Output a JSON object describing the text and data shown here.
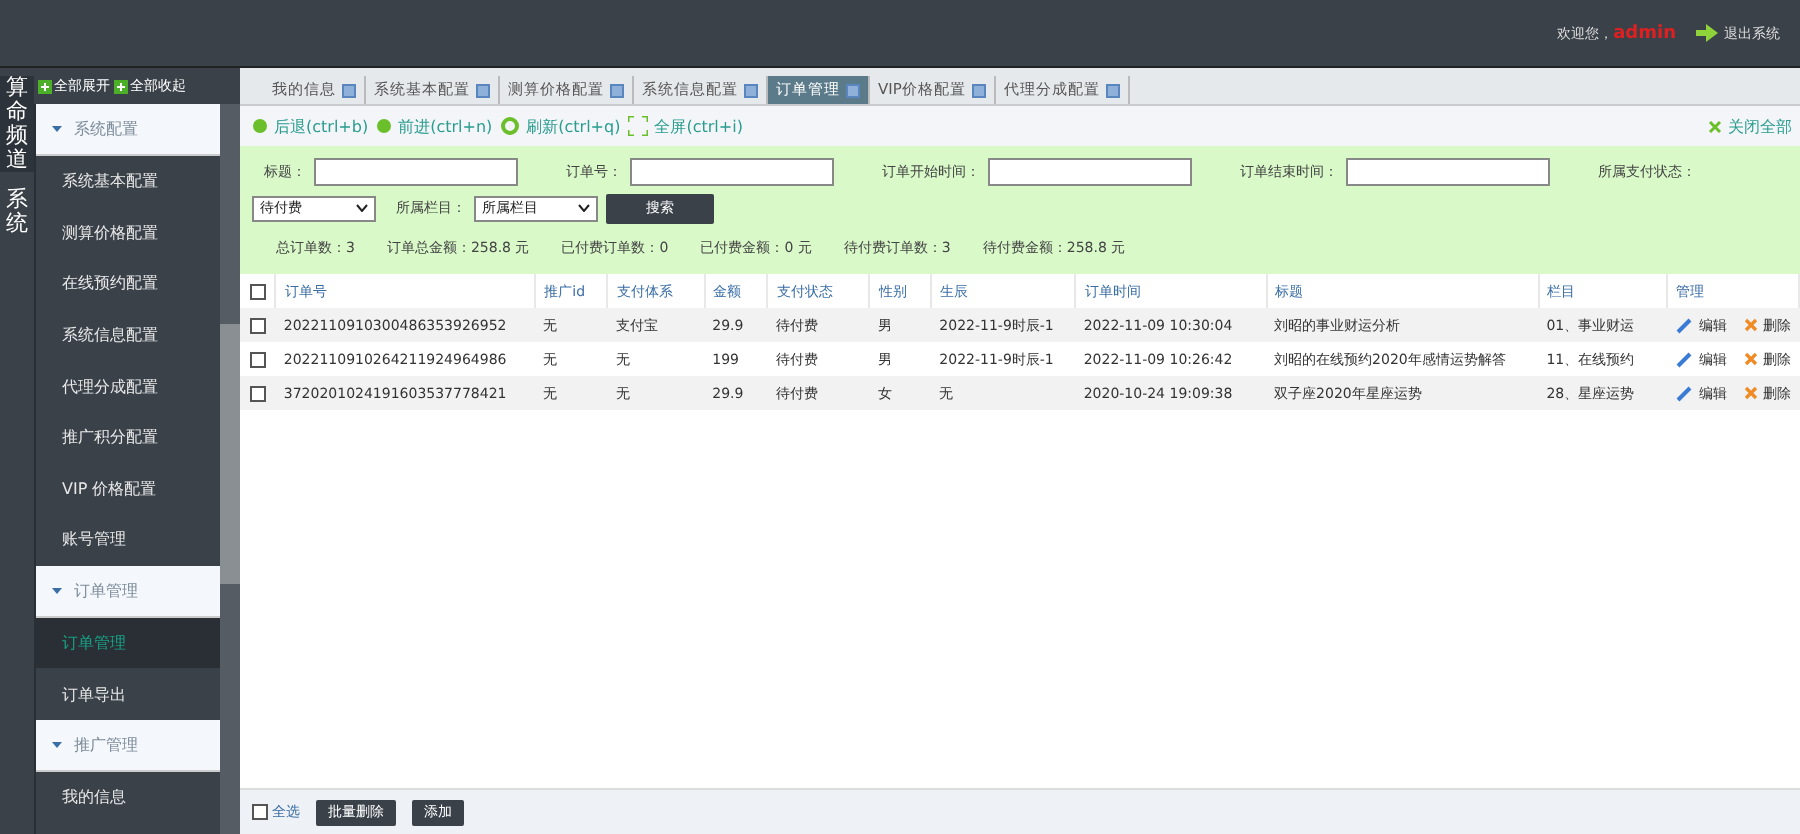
{
  "header": {
    "welcome": "欢迎您，",
    "user": "admin",
    "logout": "退出系统"
  },
  "channels": [
    {
      "label": "算命频道",
      "selected": true
    },
    {
      "label": "系统",
      "selected": false
    }
  ],
  "sidebar": {
    "expand_all": "全部展开",
    "collapse_all": "全部收起",
    "groups": [
      {
        "label": "系统配置",
        "expanded": true,
        "children": [
          {
            "label": "系统基本配置",
            "selected": false
          },
          {
            "label": "测算价格配置",
            "selected": false
          },
          {
            "label": "在线预约配置",
            "selected": false
          },
          {
            "label": "系统信息配置",
            "selected": false
          },
          {
            "label": "代理分成配置",
            "selected": false
          },
          {
            "label": "推广积分配置",
            "selected": false
          },
          {
            "label": "VIP 价格配置",
            "selected": false
          },
          {
            "label": "账号管理",
            "selected": false
          }
        ]
      },
      {
        "label": "订单管理",
        "expanded": true,
        "children": [
          {
            "label": "订单管理",
            "selected": true
          },
          {
            "label": "订单导出",
            "selected": false
          }
        ]
      },
      {
        "label": "推广管理",
        "expanded": true,
        "children": [
          {
            "label": "我的信息",
            "selected": false
          }
        ]
      }
    ]
  },
  "tabs": [
    {
      "label": "我的信息",
      "selected": false
    },
    {
      "label": "系统基本配置",
      "selected": false
    },
    {
      "label": "测算价格配置",
      "selected": false
    },
    {
      "label": "系统信息配置",
      "selected": false
    },
    {
      "label": "订单管理",
      "selected": true
    },
    {
      "label": "VIP价格配置",
      "selected": false
    },
    {
      "label": "代理分成配置",
      "selected": false
    }
  ],
  "toolbar": {
    "buttons": [
      {
        "kind": "back",
        "label": "后退(ctrl+b)"
      },
      {
        "kind": "forward",
        "label": "前进(ctrl+n)"
      },
      {
        "kind": "refresh",
        "label": "刷新(ctrl+q)"
      },
      {
        "kind": "fullscreen",
        "label": "全屏(ctrl+i)"
      }
    ],
    "close_all": "关闭全部"
  },
  "filters": {
    "title_label": "标题：",
    "order_label": "订单号：",
    "start_label": "订单开始时间：",
    "end_label": "订单结束时间：",
    "pay_status_label": "所属支付状态：",
    "pay_status_value": "待付费",
    "column_label": "所属栏目：",
    "column_value": "所属栏目",
    "search": "搜索"
  },
  "stats": [
    "总订单数：3",
    "订单总金额：258.8 元",
    "已付费订单数：0",
    "已付费金额：0 元",
    "待付费订单数：3",
    "待付费金额：258.8 元"
  ],
  "table": {
    "header_checked": false,
    "columns": [
      "订单号",
      "推广id",
      "支付体系",
      "金额",
      "支付状态",
      "性别",
      "生辰",
      "订单时间",
      "标题",
      "栏目",
      "管理"
    ],
    "rows": [
      {
        "checked": false,
        "cells": [
          "2022110910300486353926952",
          "无",
          "支付宝",
          "29.9",
          "待付费",
          "男",
          "2022-11-9时辰-1",
          "2022-11-09 10:30:04",
          "刘昭的事业财运分析",
          "01、事业财运"
        ],
        "edit": "编辑",
        "delete": "删除"
      },
      {
        "checked": false,
        "cells": [
          "2022110910264211924964986",
          "无",
          "无",
          "199",
          "待付费",
          "男",
          "2022-11-9时辰-1",
          "2022-11-09 10:26:42",
          "刘昭的在线预约2020年感情运势解答",
          "11、在线预约"
        ],
        "edit": "编辑",
        "delete": "删除"
      },
      {
        "checked": false,
        "cells": [
          "3720201024191603537778421",
          "无",
          "无",
          "29.9",
          "待付费",
          "女",
          "无",
          "2020-10-24 19:09:38",
          "双子座2020年星座运势",
          "28、星座运势"
        ],
        "edit": "编辑",
        "delete": "删除"
      }
    ]
  },
  "footer": {
    "select_all": "全选",
    "select_all_checked": false,
    "batch_delete": "批量删除",
    "add": "添加"
  }
}
